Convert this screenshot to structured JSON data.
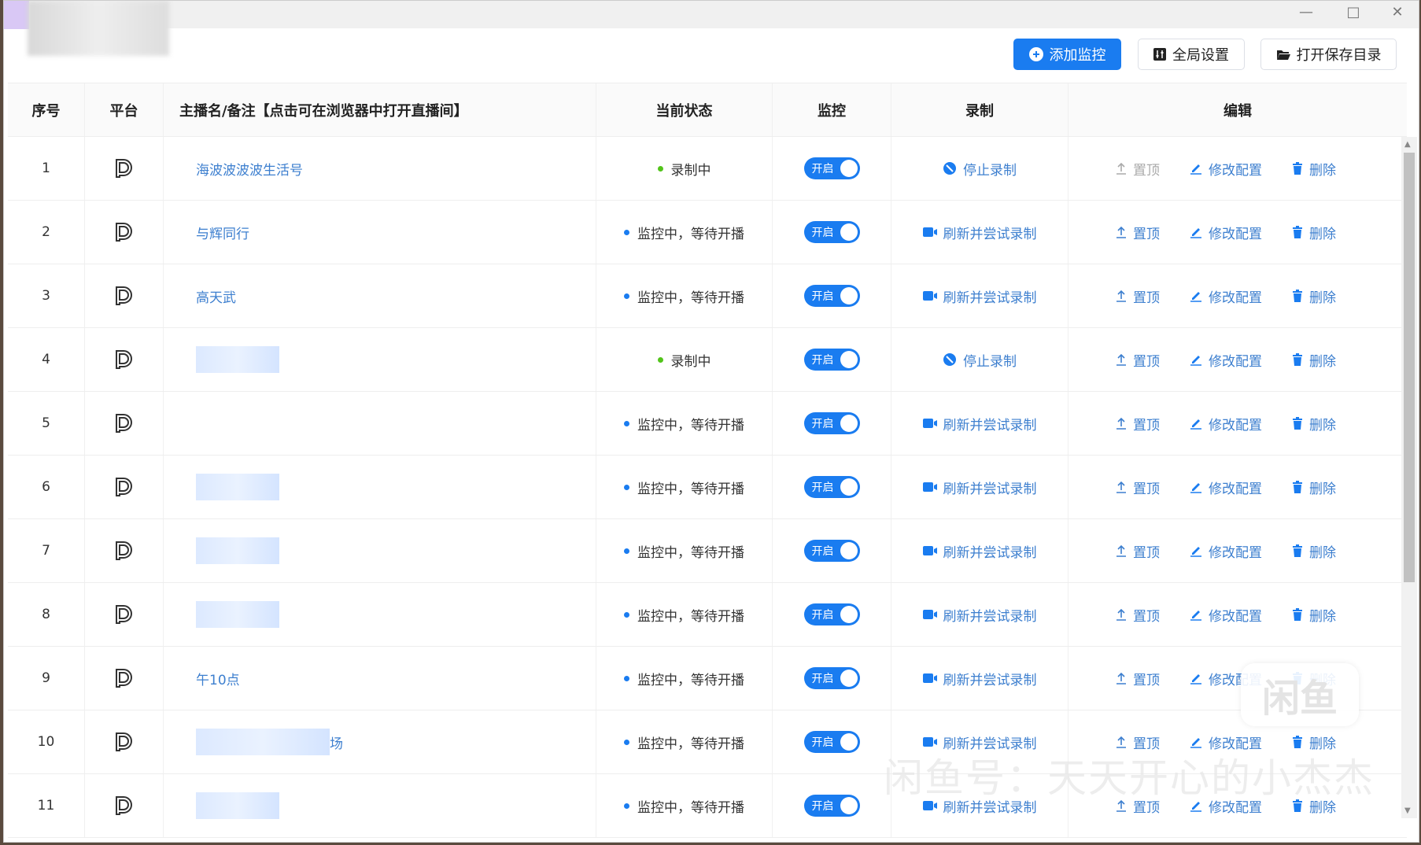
{
  "window": {
    "minimize": "—",
    "maximize": "□",
    "close": "✕"
  },
  "toolbar": {
    "add": "添加监控",
    "settings": "全局设置",
    "open_dir": "打开保存目录"
  },
  "headers": {
    "index": "序号",
    "platform": "平台",
    "name": "主播名/备注【点击可在浏览器中打开直播间】",
    "status": "当前状态",
    "monitor": "监控",
    "record": "录制",
    "edit": "编辑"
  },
  "colors": {
    "accent": "#1a7cf0",
    "recording": "#52c41a",
    "waiting": "#1a7cf0"
  },
  "labels": {
    "toggle_on": "开启",
    "stop": "停止录制",
    "retry": "刷新并尝试录制",
    "pin": "置顶",
    "modify": "修改配置",
    "delete": "删除"
  },
  "rows": [
    {
      "index": "1",
      "name": "海波波波波生活号",
      "status": "录制中",
      "recording": true,
      "pin_disabled": true
    },
    {
      "index": "2",
      "name": "与辉同行",
      "status": "监控中，等待开播",
      "recording": false
    },
    {
      "index": "3",
      "name": "高天武",
      "status": "监控中，等待开播",
      "recording": false
    },
    {
      "index": "4",
      "name": "",
      "blurred": true,
      "status": "录制中",
      "recording": true
    },
    {
      "index": "5",
      "name": "",
      "status": "监控中，等待开播",
      "recording": false
    },
    {
      "index": "6",
      "name": "",
      "blurred": true,
      "status": "监控中，等待开播",
      "recording": false
    },
    {
      "index": "7",
      "name": "",
      "blurred": true,
      "status": "监控中，等待开播",
      "recording": false
    },
    {
      "index": "8",
      "name": "",
      "blurred": true,
      "status": "监控中，等待开播",
      "recording": false
    },
    {
      "index": "9",
      "name": "午10点",
      "status": "监控中，等待开播",
      "recording": false
    },
    {
      "index": "10",
      "name": "场",
      "blurred": true,
      "status": "监控中，等待开播",
      "recording": false
    },
    {
      "index": "11",
      "name": "",
      "blurred": true,
      "status": "监控中，等待开播",
      "recording": false
    }
  ],
  "watermark": {
    "text": "闲鱼号：天天开心的小杰杰",
    "logo": "闲鱼"
  }
}
